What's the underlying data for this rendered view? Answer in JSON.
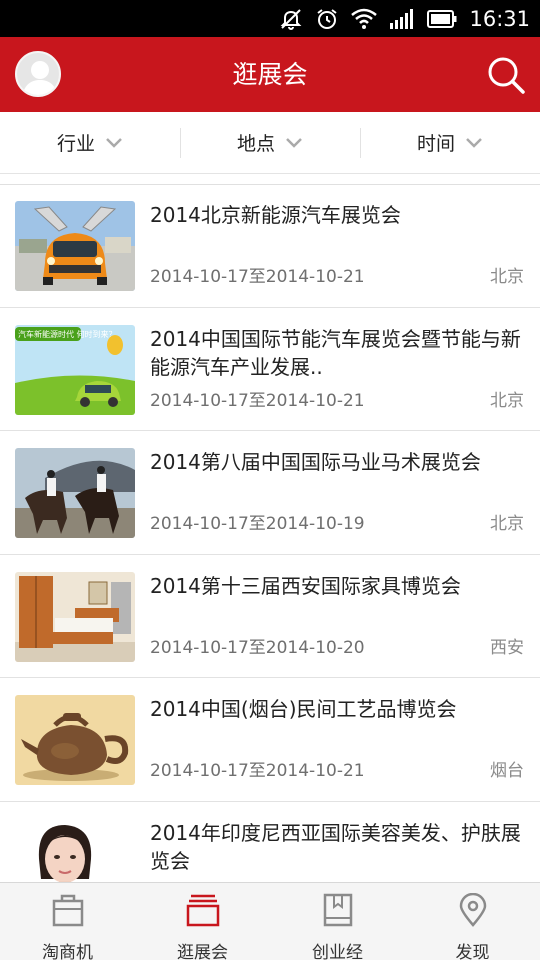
{
  "status_bar": {
    "time": "16:31"
  },
  "header": {
    "title": "逛展会"
  },
  "filters": [
    {
      "label": "行业"
    },
    {
      "label": "地点"
    },
    {
      "label": "时间"
    }
  ],
  "expos": [
    {
      "title": "2014北京新能源汽车展览会",
      "date": "2014-10-17至2014-10-21",
      "city": "北京",
      "image": "electric-car-photo"
    },
    {
      "title": "2014中国国际节能汽车展览会暨节能与新能源汽车产业发展..",
      "date": "2014-10-17至2014-10-21",
      "city": "北京",
      "image": "green-car-poster",
      "poster_text": "汽车新能源时代 何时到来？"
    },
    {
      "title": "2014第八届中国国际马业马术展览会",
      "date": "2014-10-17至2014-10-19",
      "city": "北京",
      "image": "horse-riders-photo"
    },
    {
      "title": "2014第十三届西安国际家具博览会",
      "date": "2014-10-17至2014-10-20",
      "city": "西安",
      "image": "bedroom-furniture-photo"
    },
    {
      "title": "2014中国(烟台)民间工艺品博览会",
      "date": "2014-10-17至2014-10-21",
      "city": "烟台",
      "image": "clay-teapot-photo"
    },
    {
      "title": "2014年印度尼西亚国际美容美发、护肤展览会",
      "date": "",
      "city": "",
      "image": "woman-portrait-photo"
    }
  ],
  "tabs": [
    {
      "label": "淘商机",
      "icon": "briefcase-icon",
      "active": false
    },
    {
      "label": "逛展会",
      "icon": "expo-icon",
      "active": true
    },
    {
      "label": "创业经",
      "icon": "book-icon",
      "active": false
    },
    {
      "label": "发现",
      "icon": "location-pin-icon",
      "active": false
    }
  ],
  "colors": {
    "brand_red": "#c8161d",
    "status_bar": "#000000",
    "tab_bar": "#f5f5f5"
  }
}
